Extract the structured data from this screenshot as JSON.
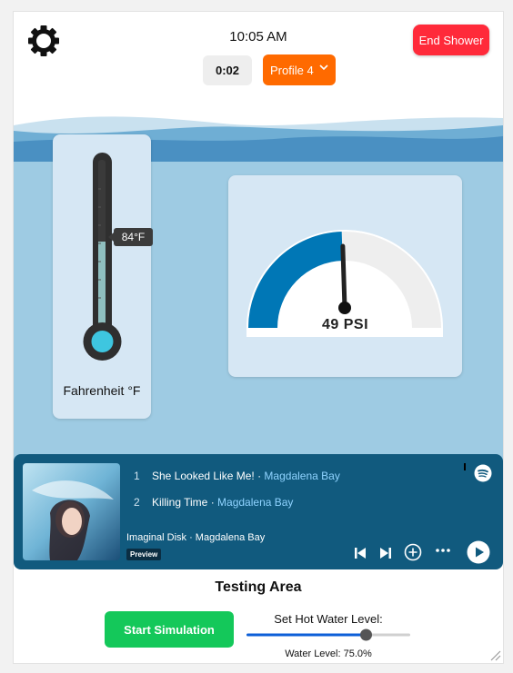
{
  "header": {
    "time": "10:05 AM",
    "timer": "0:02",
    "profile_label": "Profile 4",
    "end_label": "End Shower"
  },
  "thermometer": {
    "temperature_label": "84°F",
    "unit_label": "Fahrenheit °F",
    "fill_fraction": 0.5
  },
  "pressure": {
    "value_label": "49 PSI",
    "fraction": 0.49
  },
  "player": {
    "tracks": [
      {
        "num": "1",
        "title": "She Looked Like Me!",
        "artist": "Magdalena Bay"
      },
      {
        "num": "2",
        "title": "Killing Time",
        "artist": "Magdalena Bay"
      }
    ],
    "separator": " · ",
    "album_line": "Imaginal Disk · Magdalena Bay",
    "preview_badge": "Preview"
  },
  "testing": {
    "title": "Testing Area",
    "start_label": "Start Simulation",
    "slider_label": "Set Hot Water Level:",
    "water_level_text": "Water Level: 75.0%",
    "hot_water_fraction": 0.75
  },
  "colors": {
    "accent_orange": "#ff6a00",
    "end_red": "#ff2a3a",
    "start_green": "#14c85a",
    "player_bg": "#115a7e",
    "gauge_blue": "#0077b6"
  }
}
